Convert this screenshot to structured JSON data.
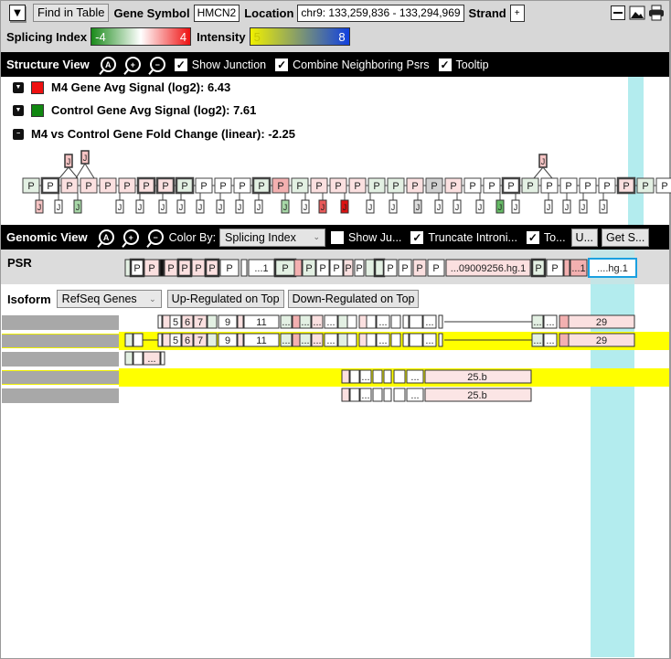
{
  "toolbar": {
    "find_in_table": "Find in Table",
    "gene_symbol_label": "Gene Symbol",
    "gene_symbol_value": "HMCN2",
    "location_label": "Location",
    "location_value": "chr9: 133,259,836 - 133,294,969",
    "strand_label": "Strand",
    "strand_value": "+",
    "icons": [
      "collapse-icon",
      "image-export-icon",
      "print-icon"
    ]
  },
  "scales": {
    "splicing_index_label": "Splicing Index",
    "splicing_min": "-4",
    "splicing_max": "4",
    "splicing_colors": [
      "#1a8a1a",
      "#ffffff",
      "#ee1111"
    ],
    "intensity_label": "Intensity",
    "intensity_min": "5",
    "intensity_max": "8",
    "intensity_colors": [
      "#f0f000",
      "#1040e0"
    ]
  },
  "structure_view": {
    "title": "Structure View",
    "show_junction": "Show Junction",
    "combine_psrs": "Combine Neighboring Psrs",
    "tooltip": "Tooltip",
    "legend": [
      {
        "label": "M4 Gene Avg Signal (log2): 6.43",
        "color": "#ee1111"
      },
      {
        "label": "Control Gene Avg Signal (log2): 7.61",
        "color": "#118811"
      },
      {
        "label": "M4 vs Control Gene Fold Change (linear): -2.25"
      }
    ],
    "psr_label": "P",
    "junction_label": "J"
  },
  "genomic_view": {
    "title": "Genomic View",
    "color_by_label": "Color By:",
    "color_by_value": "Splicing Index",
    "show_junction": "Show Ju...",
    "truncate_intronic": "Truncate Introni...",
    "to_label": "To...",
    "u_button": "U...",
    "get_button": "Get S...",
    "psr_row_label": "PSR",
    "psr_labels": {
      "p": "P",
      "one": "...1",
      "long": "...09009256.hg.1",
      "hg": "....hg.1"
    }
  },
  "isoform": {
    "label": "Isoform",
    "source_value": "RefSeq Genes",
    "up_button": "Up-Regulated on Top",
    "down_button": "Down-Regulated on Top",
    "exon_labels": [
      "5",
      "6",
      "7",
      "9",
      "11",
      "...",
      "29",
      "25.b"
    ]
  }
}
